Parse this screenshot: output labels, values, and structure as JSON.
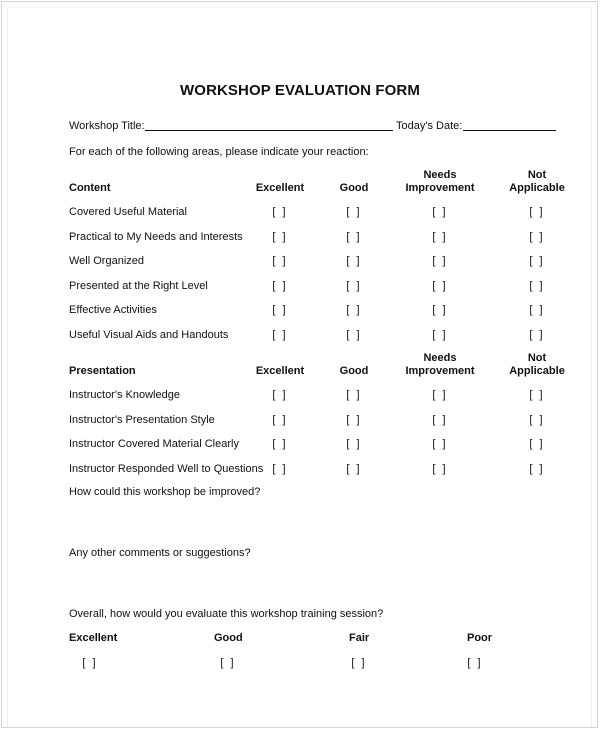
{
  "document": {
    "title": "WORKSHOP EVALUATION FORM",
    "workshop_title_label": "Workshop Title:",
    "workshop_title_value": "",
    "date_label": "Today's Date:",
    "date_value": "",
    "instructions": "For each of the following areas, please indicate your reaction:",
    "checkbox_glyph": "[ ]"
  },
  "rating_columns": [
    {
      "line1": "",
      "line2": "Excellent"
    },
    {
      "line1": "",
      "line2": "Good"
    },
    {
      "line1": "Needs",
      "line2": "Improvement"
    },
    {
      "line1": "Not",
      "line2": "Applicable"
    }
  ],
  "sections": [
    {
      "heading": "Content",
      "items": [
        "Covered Useful Material",
        "Practical to My Needs and Interests",
        "Well Organized",
        "Presented at the Right Level",
        "Effective Activities",
        "Useful Visual Aids and Handouts"
      ]
    },
    {
      "heading": "Presentation",
      "items": [
        "Instructor's Knowledge",
        "Instructor's Presentation Style",
        "Instructor Covered Material Clearly",
        "Instructor Responded Well to Questions"
      ]
    }
  ],
  "questions": {
    "improve": "How could this workshop be improved?",
    "comments": "Any other comments or suggestions?",
    "overall": "Overall, how would you evaluate this workshop training session?"
  },
  "overall_options": [
    "Excellent",
    "Good",
    "Fair",
    "Poor"
  ]
}
